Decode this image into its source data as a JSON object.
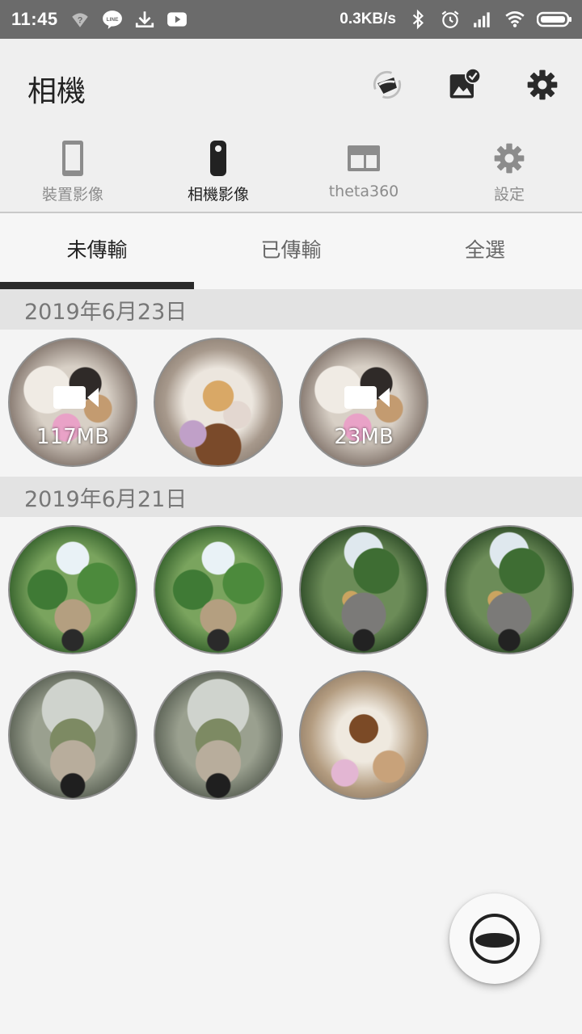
{
  "status_bar": {
    "time": "11:45",
    "network_speed": "0.3KB/s",
    "left_icons": [
      "wifi-question-icon",
      "line-app-icon",
      "download-icon",
      "youtube-icon"
    ],
    "right_icons": [
      "bluetooth-icon",
      "alarm-icon",
      "signal-icon",
      "wifi-icon",
      "battery-icon"
    ]
  },
  "app_bar": {
    "title": "相機",
    "actions": [
      "sync-camera-icon",
      "gallery-check-icon",
      "settings-gear-icon"
    ]
  },
  "mode_nav": {
    "items": [
      {
        "label": "裝置影像",
        "icon": "phone-icon",
        "active": false
      },
      {
        "label": "相機影像",
        "icon": "camera-device-icon",
        "active": true
      },
      {
        "label": "theta360",
        "icon": "web-window-icon",
        "active": false
      },
      {
        "label": "設定",
        "icon": "gear-icon",
        "active": false
      }
    ]
  },
  "tabs": {
    "items": [
      {
        "label": "未傳輸",
        "active": true
      },
      {
        "label": "已傳輸",
        "active": false
      },
      {
        "label": "全選",
        "active": false
      }
    ]
  },
  "sections": [
    {
      "date": "2019年6月23日",
      "items": [
        {
          "type": "video",
          "size": "117MB",
          "scene": "indoor2"
        },
        {
          "type": "photo",
          "size": "",
          "scene": "indoor"
        },
        {
          "type": "video",
          "size": "23MB",
          "scene": "indoor2"
        }
      ]
    },
    {
      "date": "2019年6月21日",
      "items": [
        {
          "type": "photo",
          "size": "",
          "scene": "garden"
        },
        {
          "type": "photo",
          "size": "",
          "scene": "garden"
        },
        {
          "type": "photo",
          "size": "",
          "scene": "garden2"
        },
        {
          "type": "photo",
          "size": "",
          "scene": "garden2"
        },
        {
          "type": "photo",
          "size": "",
          "scene": "greenhouse"
        },
        {
          "type": "photo",
          "size": "",
          "scene": "greenhouse"
        },
        {
          "type": "photo",
          "size": "",
          "scene": "indoor3"
        }
      ]
    }
  ],
  "fab": {
    "icon": "theta-camera-icon"
  },
  "colors": {
    "status_bar": "#6b6b6b",
    "app_bar": "#efefef",
    "tab_indicator": "#2b2b2b",
    "date_header": "#e3e3e3"
  }
}
